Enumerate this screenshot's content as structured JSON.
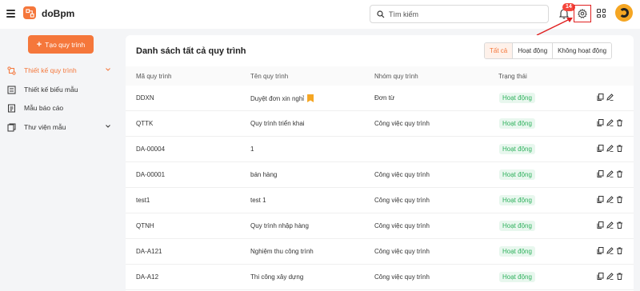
{
  "header": {
    "brand": "doBpm",
    "search_placeholder": "Tìm kiếm",
    "notification_count": "14",
    "icons": [
      "menu-icon",
      "logo-icon",
      "search-icon",
      "bell-icon",
      "gear-icon",
      "apps-grid-icon",
      "avatar"
    ]
  },
  "sidebar": {
    "create_button": "Tạo quy trình",
    "items": [
      {
        "label": "Thiết kế quy trình",
        "icon": "workflow-icon",
        "active": true,
        "expandable": true
      },
      {
        "label": "Thiết kế biểu mẫu",
        "icon": "form-icon",
        "active": false,
        "expandable": false
      },
      {
        "label": "Mẫu báo cáo",
        "icon": "report-icon",
        "active": false,
        "expandable": false
      },
      {
        "label": "Thư viện mẫu",
        "icon": "library-icon",
        "active": false,
        "expandable": true
      }
    ]
  },
  "main": {
    "title": "Danh sách tất cả quy trình",
    "filters": [
      {
        "label": "Tất cả",
        "active": true
      },
      {
        "label": "Hoạt động",
        "active": false
      },
      {
        "label": "Không hoạt động",
        "active": false
      }
    ],
    "columns": [
      "Mã quy trình",
      "Tên quy trình",
      "Nhóm quy trình",
      "Trạng thái"
    ],
    "rows": [
      {
        "code": "DDXN",
        "name": "Duyệt đơn xin nghỉ",
        "group": "Đơn từ",
        "status": "Hoạt động",
        "bookmarked": true,
        "deletable": false
      },
      {
        "code": "QTTK",
        "name": "Quy trình triển khai",
        "group": "Công việc quy trình",
        "status": "Hoạt động",
        "bookmarked": false,
        "deletable": true
      },
      {
        "code": "DA-00004",
        "name": "1",
        "group": "",
        "status": "Hoạt động",
        "bookmarked": false,
        "deletable": true
      },
      {
        "code": "DA-00001",
        "name": "bán hàng",
        "group": "Công việc quy trình",
        "status": "Hoạt động",
        "bookmarked": false,
        "deletable": true
      },
      {
        "code": "test1",
        "name": "test 1",
        "group": "Công việc quy trình",
        "status": "Hoạt động",
        "bookmarked": false,
        "deletable": true
      },
      {
        "code": "QTNH",
        "name": "Quy trình nhập hàng",
        "group": "Công việc quy trình",
        "status": "Hoạt động",
        "bookmarked": false,
        "deletable": true
      },
      {
        "code": "DA-A121",
        "name": "Nghiệm thu công trình",
        "group": "Công việc quy trình",
        "status": "Hoạt động",
        "bookmarked": false,
        "deletable": true
      },
      {
        "code": "DA-A12",
        "name": "Thi công xây dựng",
        "group": "Công việc quy trình",
        "status": "Hoạt động",
        "bookmarked": false,
        "deletable": true
      }
    ]
  },
  "colors": {
    "accent": "#f5773b",
    "status_bg": "#e8f7ee",
    "status_text": "#2fb15d",
    "badge": "#f5453b",
    "highlight": "#e02020"
  }
}
